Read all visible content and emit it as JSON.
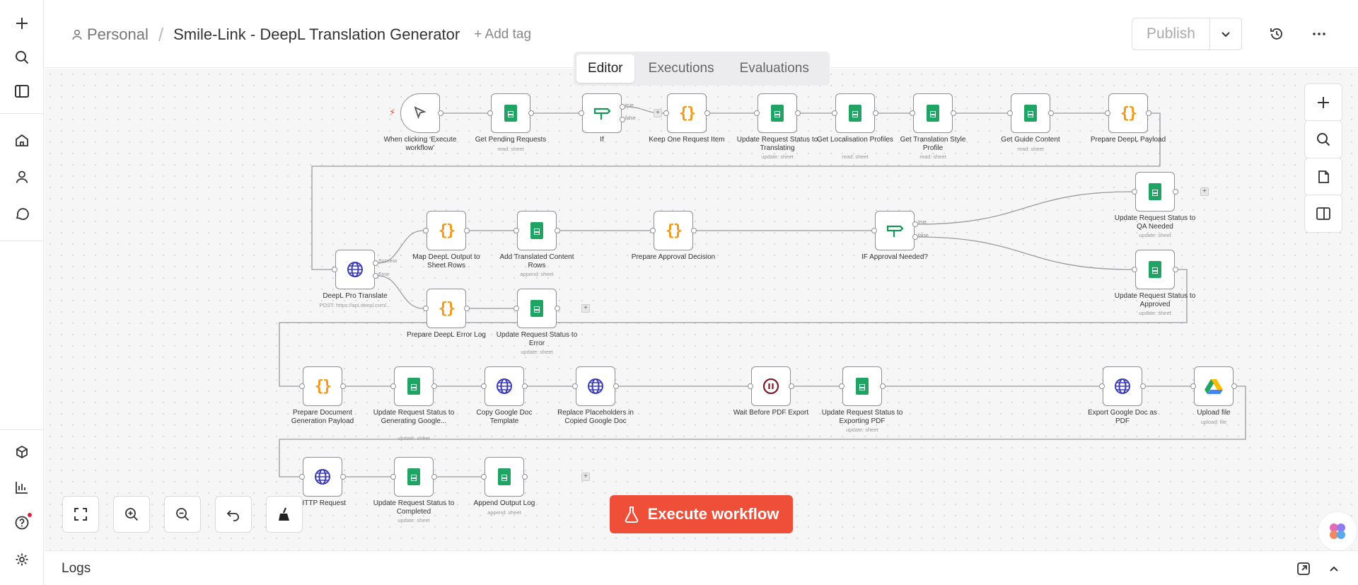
{
  "header": {
    "project": "Personal",
    "workflow_name": "Smile-Link - DeepL Translation Generator",
    "add_tag": "+ Add tag",
    "publish": "Publish"
  },
  "tabs": [
    "Editor",
    "Executions",
    "Evaluations"
  ],
  "logs_label": "Logs",
  "execute_button": "Execute workflow",
  "nodes": [
    {
      "label": "When clicking ‘Execute workflow’",
      "sub": ""
    },
    {
      "label": "Get Pending Requests",
      "sub": "read: sheet"
    },
    {
      "label": "If",
      "sub": ""
    },
    {
      "label": "Keep One Request Item",
      "sub": ""
    },
    {
      "label": "Update Request Status to Translating",
      "sub": "update: sheet"
    },
    {
      "label": "Get Localisation Profiles",
      "sub": "read: sheet"
    },
    {
      "label": "Get Translation Style Profile",
      "sub": "read: sheet"
    },
    {
      "label": "Get Guide Content",
      "sub": "read: sheet"
    },
    {
      "label": "Prepare DeepL Payload",
      "sub": ""
    },
    {
      "label": "DeepL Pro Translate",
      "sub": "POST: https://api.deepl.com/..."
    },
    {
      "label": "Map DeepL Output to Sheet Rows",
      "sub": ""
    },
    {
      "label": "Add Translated Content Rows",
      "sub": "append: sheet"
    },
    {
      "label": "Prepare Approval Decision",
      "sub": ""
    },
    {
      "label": "IF Approval Needed?",
      "sub": ""
    },
    {
      "label": "Update Request Status to QA Needed",
      "sub": "update: sheet"
    },
    {
      "label": "Update Request Status to Approved",
      "sub": "update: sheet"
    },
    {
      "label": "Prepare DeepL Error Log",
      "sub": ""
    },
    {
      "label": "Update Request Status to Error",
      "sub": "update: sheet"
    },
    {
      "label": "Prepare Document Generation Payload",
      "sub": ""
    },
    {
      "label": "Update Request Status to Generating Google...",
      "sub": "update: sheet"
    },
    {
      "label": "Copy Google Doc Template",
      "sub": ""
    },
    {
      "label": "Replace Placeholders in Copied Google Doc",
      "sub": ""
    },
    {
      "label": "Wait Before PDF Export",
      "sub": ""
    },
    {
      "label": "Update Request Status to Exporting PDF",
      "sub": "update: sheet"
    },
    {
      "label": "Export Google Doc as PDF",
      "sub": ""
    },
    {
      "label": "Upload file",
      "sub": "upload: file"
    },
    {
      "label": "HTTP Request",
      "sub": ""
    },
    {
      "label": "Update Request Status to Completed",
      "sub": "update: sheet"
    },
    {
      "label": "Append Output Log",
      "sub": "append: sheet"
    }
  ],
  "port_labels": {
    "if_true": "true",
    "if_false": "false",
    "deepl_success": "Success",
    "deepl_error": "Error",
    "approval_true": "true",
    "approval_false": "false"
  },
  "icons": {
    "trigger": "cursor-icon",
    "sheet": "google-sheets-icon",
    "code": "code-icon",
    "if": "signpost-icon",
    "http": "globe-icon",
    "wait": "pause-icon",
    "drive": "google-drive-icon"
  },
  "colors": {
    "accent": "#ef4e38",
    "sheets": "#1fa463",
    "code": "#f29a18",
    "if": "#149455",
    "http": "#3b3bb8",
    "wait": "#7a1d2b"
  }
}
